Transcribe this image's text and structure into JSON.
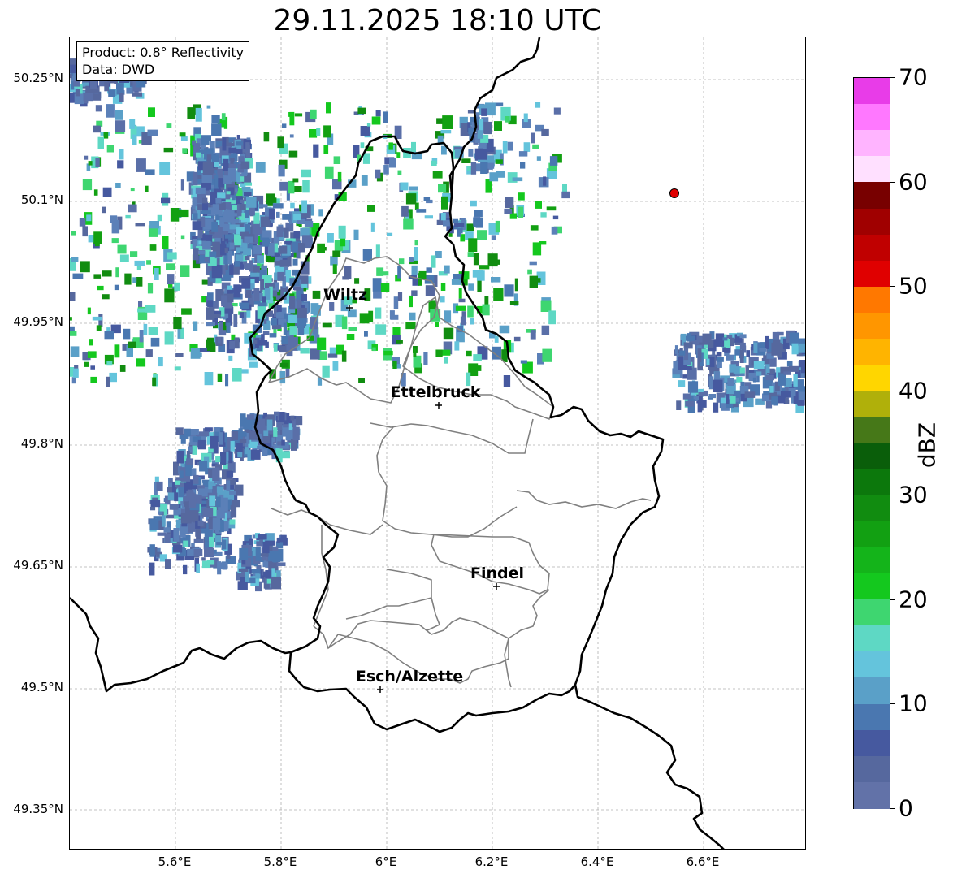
{
  "title": "29.11.2025 18:10 UTC",
  "infobox": {
    "product": "Product: 0.8° Reflectivity",
    "source": "Data: DWD"
  },
  "lat_labels": [
    "50.25°N",
    "50.1°N",
    "49.95°N",
    "49.8°N",
    "49.65°N",
    "49.5°N",
    "49.35°N"
  ],
  "lon_labels": [
    "5.6°E",
    "5.8°E",
    "6°E",
    "6.2°E",
    "6.4°E",
    "6.6°E"
  ],
  "cities": [
    {
      "name": "Wiltz",
      "id": "wiltz"
    },
    {
      "name": "Ettelbruck",
      "id": "ettelbruck"
    },
    {
      "name": "Findel",
      "id": "findel"
    },
    {
      "name": "Esch/Alzette",
      "id": "esch"
    }
  ],
  "colorbar": {
    "unit": "dBZ",
    "labels": [
      "0",
      "10",
      "20",
      "30",
      "40",
      "50",
      "60",
      "70"
    ],
    "colors": [
      "#6272a8",
      "#56689e",
      "#46599f",
      "#4a77b0",
      "#5aa0c8",
      "#64c4dc",
      "#5ed8c4",
      "#3ed670",
      "#14c81e",
      "#14b41a",
      "#12a012",
      "#118c10",
      "#0c780c",
      "#0a5e0a",
      "#467818",
      "#b0b00a",
      "#ffd600",
      "#ffb400",
      "#ff9600",
      "#ff7800",
      "#e00000",
      "#c00000",
      "#a00000",
      "#780000",
      "#ffe0ff",
      "#ffb4ff",
      "#ff78ff",
      "#e83ce8"
    ]
  },
  "colors": {
    "border": "#000000",
    "canton": "#808080",
    "marker": "#e00000",
    "grid": "#b0b0b0"
  }
}
